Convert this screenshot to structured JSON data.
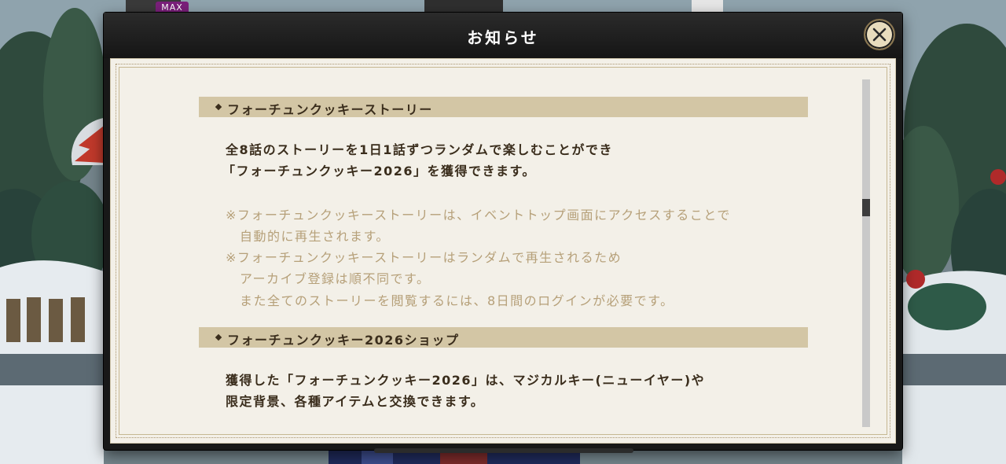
{
  "hud": {
    "max_badge": "MAX"
  },
  "modal": {
    "title": "お知らせ",
    "close_icon": "close-icon",
    "sections": [
      {
        "heading": "フォーチュンクッキーストーリー",
        "body": [
          "全8話のストーリーを1日1話ずつランダムで楽しむことができ",
          "「フォーチュンクッキー2026」を獲得できます。"
        ],
        "notes": [
          "※フォーチュンクッキーストーリーは、イベントトップ画面にアクセスすることで",
          "自動的に再生されます。",
          "※フォーチュンクッキーストーリーはランダムで再生されるため",
          "アーカイブ登録は順不同です。",
          "また全てのストーリーを閲覧するには、8日間のログインが必要です。"
        ]
      },
      {
        "heading": "フォーチュンクッキー2026ショップ",
        "body": [
          "獲得した「フォーチュンクッキー2026」は、マジカルキー(ニューイヤー)や",
          "限定背景、各種アイテムと交換できます。"
        ]
      }
    ]
  },
  "colors": {
    "modal_header": "#181818",
    "panel_bg": "#f3f0e8",
    "section_bar": "#d3c6a5",
    "main_text": "#3a2d1c",
    "note_text": "#b6a079",
    "close_button": "#e8dcbd"
  }
}
